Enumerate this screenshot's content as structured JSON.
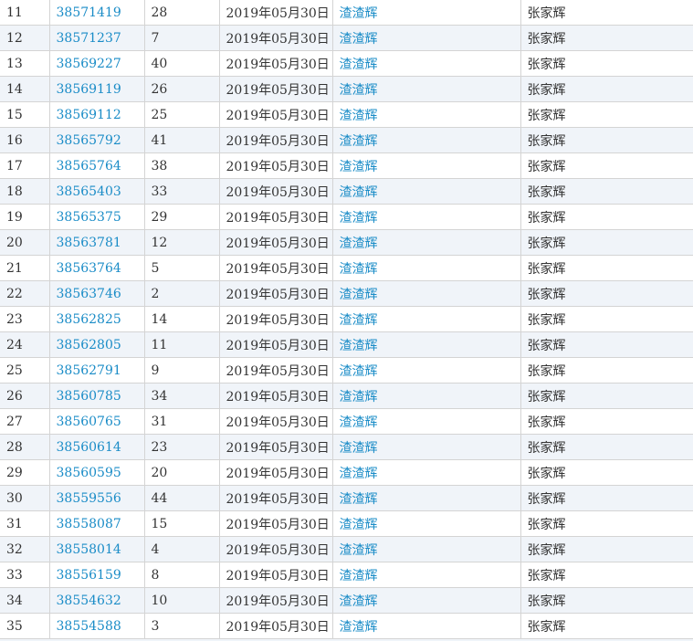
{
  "table": {
    "rows": [
      {
        "index": "11",
        "id": "38571419",
        "count": "28",
        "date": "2019年05月30日",
        "author": "渣渣辉",
        "name": "张家辉"
      },
      {
        "index": "12",
        "id": "38571237",
        "count": "7",
        "date": "2019年05月30日",
        "author": "渣渣辉",
        "name": "张家辉"
      },
      {
        "index": "13",
        "id": "38569227",
        "count": "40",
        "date": "2019年05月30日",
        "author": "渣渣辉",
        "name": "张家辉"
      },
      {
        "index": "14",
        "id": "38569119",
        "count": "26",
        "date": "2019年05月30日",
        "author": "渣渣辉",
        "name": "张家辉"
      },
      {
        "index": "15",
        "id": "38569112",
        "count": "25",
        "date": "2019年05月30日",
        "author": "渣渣辉",
        "name": "张家辉"
      },
      {
        "index": "16",
        "id": "38565792",
        "count": "41",
        "date": "2019年05月30日",
        "author": "渣渣辉",
        "name": "张家辉"
      },
      {
        "index": "17",
        "id": "38565764",
        "count": "38",
        "date": "2019年05月30日",
        "author": "渣渣辉",
        "name": "张家辉"
      },
      {
        "index": "18",
        "id": "38565403",
        "count": "33",
        "date": "2019年05月30日",
        "author": "渣渣辉",
        "name": "张家辉"
      },
      {
        "index": "19",
        "id": "38565375",
        "count": "29",
        "date": "2019年05月30日",
        "author": "渣渣辉",
        "name": "张家辉"
      },
      {
        "index": "20",
        "id": "38563781",
        "count": "12",
        "date": "2019年05月30日",
        "author": "渣渣辉",
        "name": "张家辉"
      },
      {
        "index": "21",
        "id": "38563764",
        "count": "5",
        "date": "2019年05月30日",
        "author": "渣渣辉",
        "name": "张家辉"
      },
      {
        "index": "22",
        "id": "38563746",
        "count": "2",
        "date": "2019年05月30日",
        "author": "渣渣辉",
        "name": "张家辉"
      },
      {
        "index": "23",
        "id": "38562825",
        "count": "14",
        "date": "2019年05月30日",
        "author": "渣渣辉",
        "name": "张家辉"
      },
      {
        "index": "24",
        "id": "38562805",
        "count": "11",
        "date": "2019年05月30日",
        "author": "渣渣辉",
        "name": "张家辉"
      },
      {
        "index": "25",
        "id": "38562791",
        "count": "9",
        "date": "2019年05月30日",
        "author": "渣渣辉",
        "name": "张家辉"
      },
      {
        "index": "26",
        "id": "38560785",
        "count": "34",
        "date": "2019年05月30日",
        "author": "渣渣辉",
        "name": "张家辉"
      },
      {
        "index": "27",
        "id": "38560765",
        "count": "31",
        "date": "2019年05月30日",
        "author": "渣渣辉",
        "name": "张家辉"
      },
      {
        "index": "28",
        "id": "38560614",
        "count": "23",
        "date": "2019年05月30日",
        "author": "渣渣辉",
        "name": "张家辉"
      },
      {
        "index": "29",
        "id": "38560595",
        "count": "20",
        "date": "2019年05月30日",
        "author": "渣渣辉",
        "name": "张家辉"
      },
      {
        "index": "30",
        "id": "38559556",
        "count": "44",
        "date": "2019年05月30日",
        "author": "渣渣辉",
        "name": "张家辉"
      },
      {
        "index": "31",
        "id": "38558087",
        "count": "15",
        "date": "2019年05月30日",
        "author": "渣渣辉",
        "name": "张家辉"
      },
      {
        "index": "32",
        "id": "38558014",
        "count": "4",
        "date": "2019年05月30日",
        "author": "渣渣辉",
        "name": "张家辉"
      },
      {
        "index": "33",
        "id": "38556159",
        "count": "8",
        "date": "2019年05月30日",
        "author": "渣渣辉",
        "name": "张家辉"
      },
      {
        "index": "34",
        "id": "38554632",
        "count": "10",
        "date": "2019年05月30日",
        "author": "渣渣辉",
        "name": "张家辉"
      },
      {
        "index": "35",
        "id": "38554588",
        "count": "3",
        "date": "2019年05月30日",
        "author": "渣渣辉",
        "name": "张家辉"
      }
    ]
  },
  "colors": {
    "link": "#1a8cc7",
    "stripe": "#f0f4f9",
    "border": "#d4d4d4",
    "text": "#333333"
  }
}
